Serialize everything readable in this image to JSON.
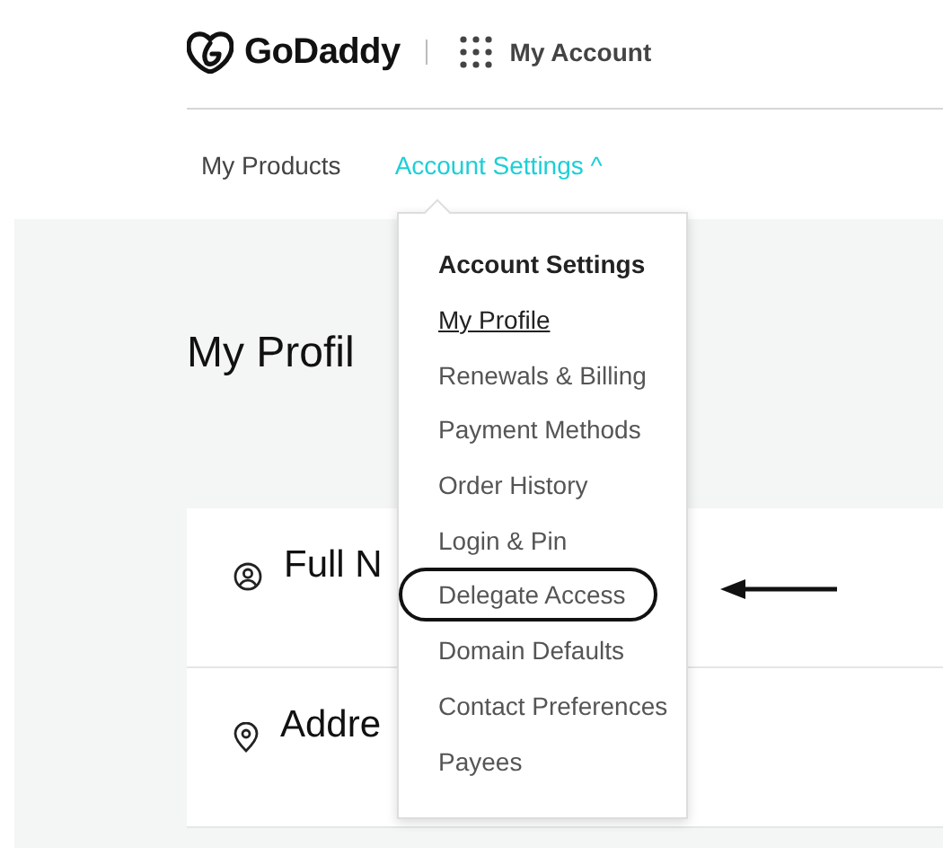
{
  "header": {
    "brand": "GoDaddy",
    "app": "My Account"
  },
  "nav": [
    {
      "label": "My Products",
      "selected": false
    },
    {
      "label": "Account Settings",
      "selected": true,
      "caret": "^"
    }
  ],
  "page": {
    "title": "My Profil",
    "rows": [
      {
        "kind": "person",
        "label": "Full N"
      },
      {
        "kind": "pin",
        "label": "Addre"
      }
    ]
  },
  "menu": {
    "heading": "Account Settings",
    "items": [
      {
        "label": "My Profile",
        "selected": true,
        "circled": false
      },
      {
        "label": "Renewals & Billing",
        "selected": false,
        "circled": false
      },
      {
        "label": "Payment Methods",
        "selected": false,
        "circled": false
      },
      {
        "label": "Order History",
        "selected": false,
        "circled": false
      },
      {
        "label": "Login & Pin",
        "selected": false,
        "circled": false
      },
      {
        "label": "Delegate Access",
        "selected": false,
        "circled": true
      },
      {
        "label": "Domain Defaults",
        "selected": false,
        "circled": false
      },
      {
        "label": "Contact Preferences",
        "selected": false,
        "circled": false
      },
      {
        "label": "Payees",
        "selected": false,
        "circled": false
      }
    ]
  }
}
